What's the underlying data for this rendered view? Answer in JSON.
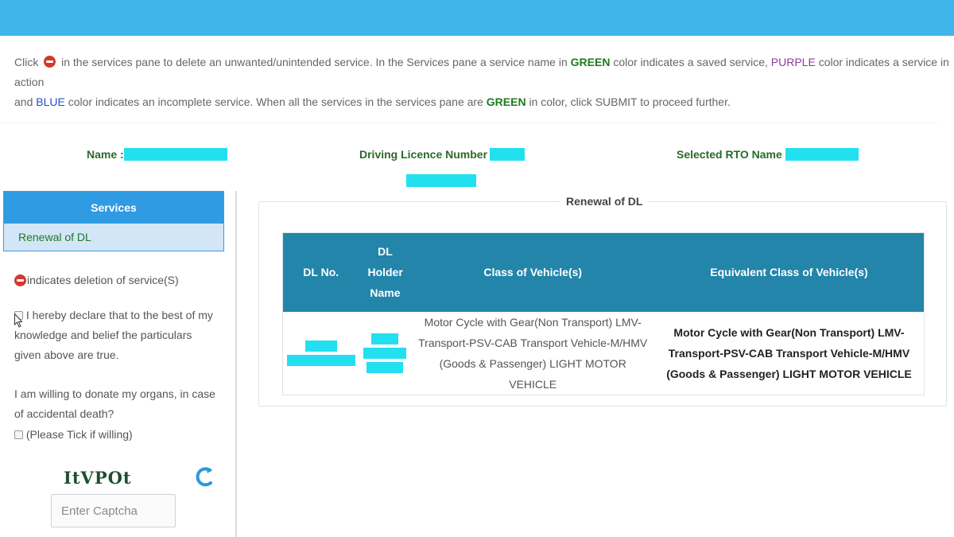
{
  "instructions": {
    "part1": "Click",
    "part2": "in the services pane to delete an unwanted/unintended service. In the Services pane a service name in",
    "green1": "GREEN",
    "part3": "color indicates a saved service,",
    "purple": "PURPLE",
    "part4": "color indicates a service in action",
    "part5": "and",
    "blue": "BLUE",
    "part6": "color indicates an incomplete service. When all the services in the services pane are",
    "green2": "GREEN",
    "part7": "in color, click SUBMIT to proceed further."
  },
  "applicant": {
    "name_label": "Name :",
    "dl_number_label": "Driving Licence Number :",
    "rto_label": "Selected RTO Name :"
  },
  "services": {
    "header": "Services",
    "items": [
      {
        "label": "Renewal of DL"
      }
    ],
    "legend_text": "indicates deletion of service(S)"
  },
  "declaration": {
    "text": "I hereby declare that to the best of my knowledge and belief the particulars given above are true."
  },
  "organ_donation": {
    "question": "I am willing to donate my organs, in case of accidental death?",
    "checkbox_label": "(Please Tick if willing)"
  },
  "captcha": {
    "text": "ItVPOt",
    "placeholder": "Enter Captcha"
  },
  "renewal_section": {
    "title": "Renewal of DL",
    "columns": [
      "DL No.",
      "DL Holder Name",
      "Class of Vehicle(s)",
      "Equivalent Class of Vehicle(s)"
    ],
    "row": {
      "class_of_vehicles": "Motor Cycle with Gear(Non Transport) LMV-Transport-PSV-CAB Transport Vehicle-M/HMV (Goods & Passenger) LIGHT MOTOR VEHICLE",
      "equivalent_class": "Motor Cycle with Gear(Non Transport) LMV-Transport-PSV-CAB Transport Vehicle-M/HMV (Goods & Passenger) LIGHT MOTOR VEHICLE"
    }
  },
  "colors": {
    "topbar": "#3fb6ea",
    "green": "#1f7a1f",
    "purple": "#8e3a9e",
    "blue": "#1f4fd0",
    "table_header": "#2285a9",
    "redaction": "#22e0f0"
  }
}
